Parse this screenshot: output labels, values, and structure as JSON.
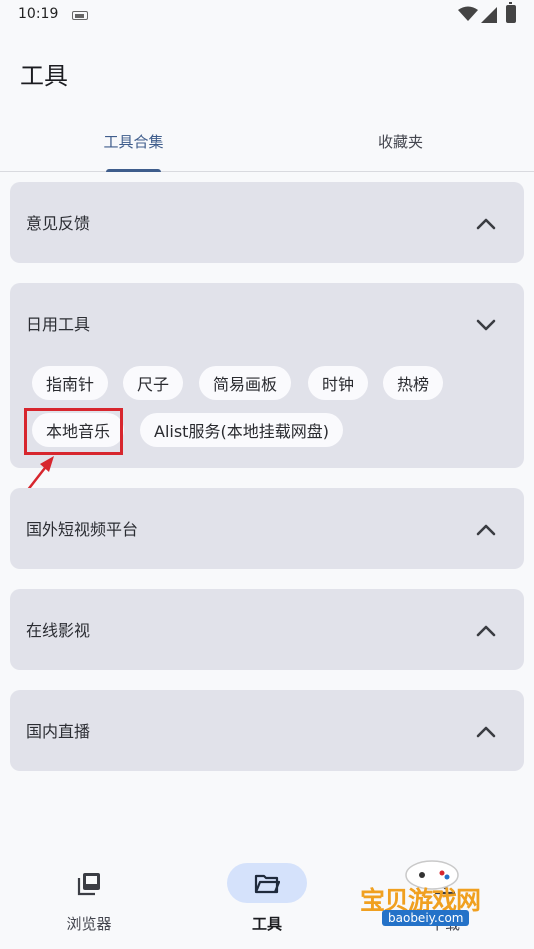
{
  "status_bar": {
    "time": "10:19"
  },
  "page_title": "工具",
  "tabs": [
    {
      "label": "工具合集",
      "active": true
    },
    {
      "label": "收藏夹",
      "active": false
    }
  ],
  "sections": [
    {
      "title": "意见反馈",
      "expanded": false,
      "chips": []
    },
    {
      "title": "日用工具",
      "expanded": true,
      "chips": [
        "指南针",
        "尺子",
        "简易画板",
        "时钟",
        "热榜",
        "本地音乐",
        "Alist服务(本地挂载网盘)"
      ]
    },
    {
      "title": "国外短视频平台",
      "expanded": false,
      "chips": []
    },
    {
      "title": "在线影视",
      "expanded": false,
      "chips": []
    },
    {
      "title": "国内直播",
      "expanded": false,
      "chips": []
    }
  ],
  "bottom_nav": [
    {
      "label": "浏览器",
      "icon": "library-icon",
      "active": false
    },
    {
      "label": "工具",
      "icon": "folder-open-icon",
      "active": true
    },
    {
      "label": "下载",
      "icon": "download-icon",
      "active": false
    }
  ],
  "watermark": {
    "title": "宝贝游戏网",
    "url": "baobeiy.com"
  },
  "colors": {
    "accent": "#3f5d8c",
    "card_bg": "#e1e2ea",
    "highlight": "#d7262e",
    "nav_active": "#d5e2fb"
  }
}
